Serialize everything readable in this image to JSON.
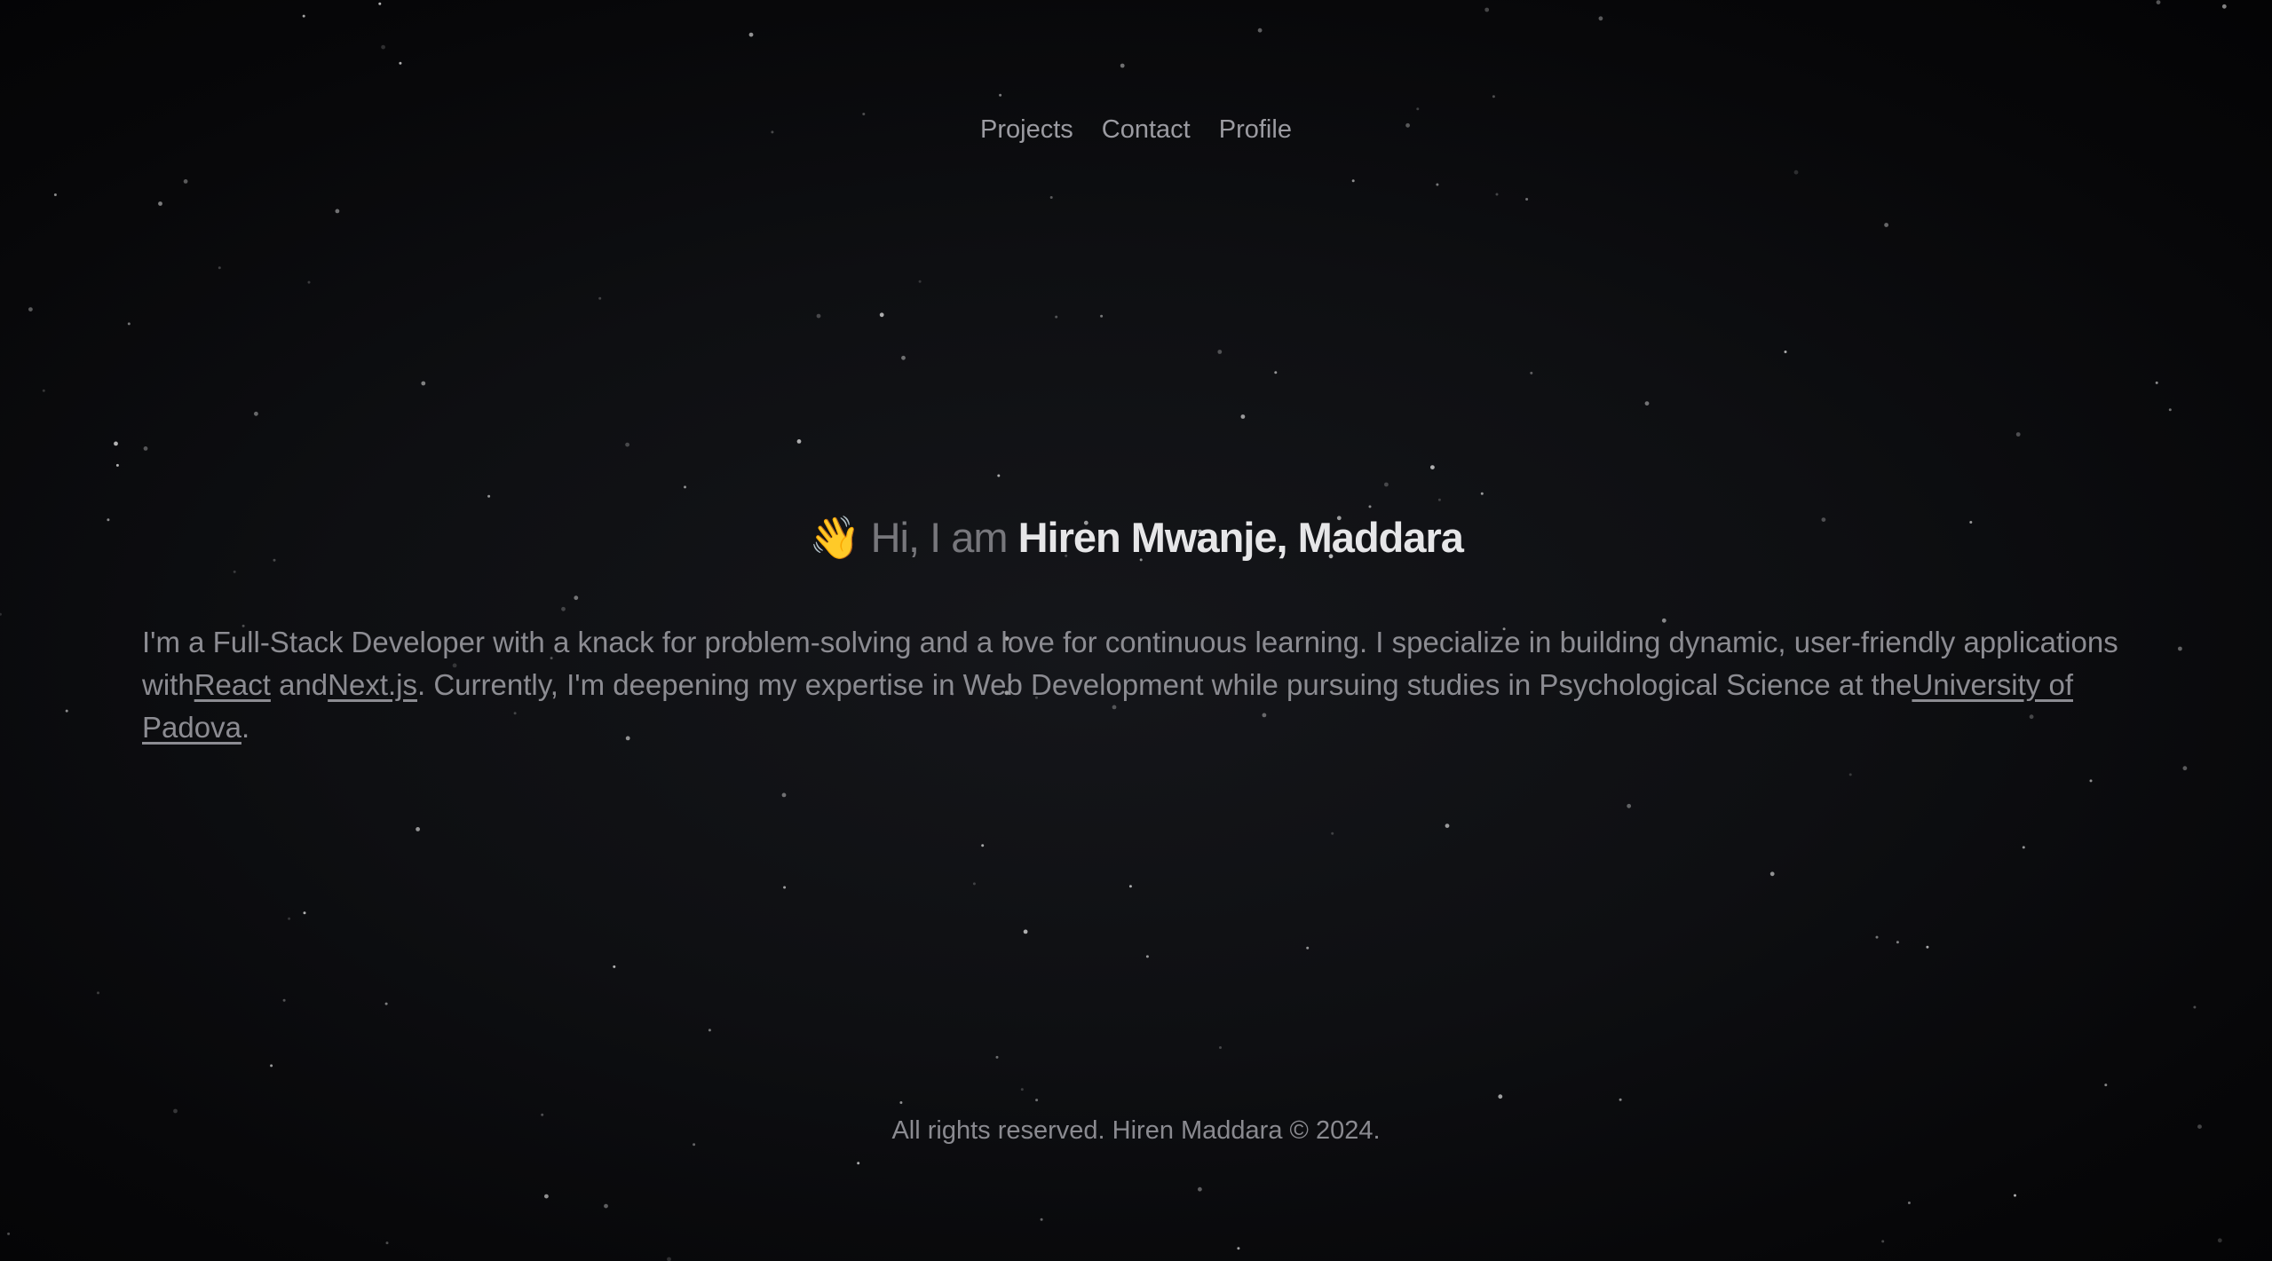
{
  "nav": {
    "items": [
      {
        "label": "Projects"
      },
      {
        "label": "Contact"
      },
      {
        "label": "Profile"
      }
    ]
  },
  "hero": {
    "emoji": "👋",
    "greeting": "Hi, I am",
    "name": "Hiren Mwanje, Maddara"
  },
  "bio": {
    "text1": "I'm a Full-Stack Developer with a knack for problem-solving and a love for continuous learning. I specialize in building dynamic, user-friendly applications with",
    "link1": "React",
    "text2": " and",
    "link2": "Next.js",
    "text3": ". Currently, I'm deepening my expertise in Web Development while pursuing studies in Psychological Science at the",
    "link3": "University of Padova",
    "text4": "."
  },
  "footer": {
    "text": "All rights reserved. Hiren Maddara © 2024."
  },
  "colors": {
    "background": "#0e0f12",
    "text_muted": "#8c8c92",
    "name_highlight": "#e6e6e8"
  }
}
